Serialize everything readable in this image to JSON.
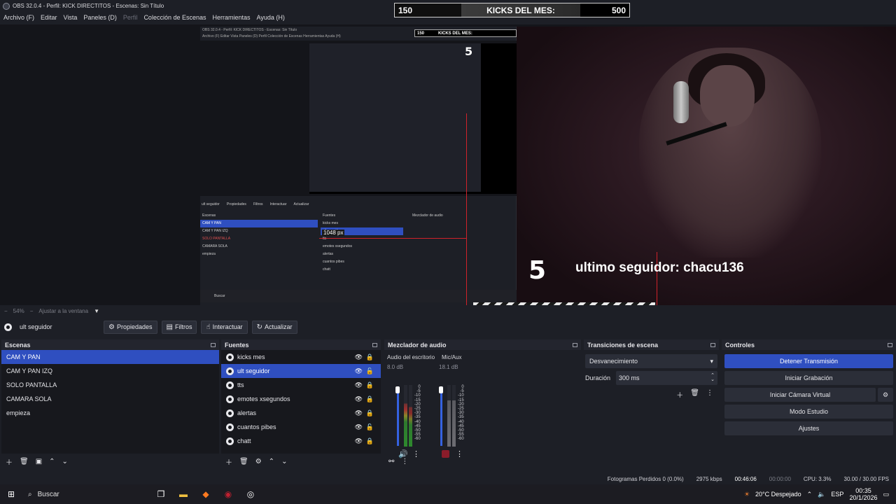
{
  "window": {
    "title": "OBS 32.0.4 - Perfil: KICK DIRECTITOS - Escenas: Sin Título"
  },
  "menu": [
    "Archivo (F)",
    "Editar",
    "Vista",
    "Paneles (D)",
    "Perfil",
    "Colección de Escenas",
    "Herramientas",
    "Ayuda (H)"
  ],
  "overlay": {
    "kicks_current": "150",
    "kicks_label": "KICKS DEL MES:",
    "kicks_goal": "500",
    "counter": "5",
    "last_follower": "ultimo seguidor: chacu136",
    "measure_label": "1048 px"
  },
  "nested": {
    "title": "OBS 32.0.4 - Perfil: KICK DIRECTITOS - Escenas: Sin Título",
    "menu": "Archivo (F)   Editar   Vista   Paneles (D)   Perfil   Colección de Escenas   Herramientas   Ayuda (H)",
    "banner_left": "150",
    "banner_label": "KICKS DEL MES:",
    "toolbar": [
      "ult seguidor",
      "Propiedades",
      "Filtros",
      "Interactuar",
      "Actualizar"
    ],
    "scenes_header": "Escenas",
    "sources_header": "Fuentes",
    "mixer_header": "Mezclador de audio",
    "scenes": [
      "CAM Y PAN",
      "CAM Y PAN IZQ",
      "SOLO PANTALLA",
      "CAMARA SOLA",
      "empieza"
    ],
    "sources": [
      "kicks mes",
      "ult seguidor",
      "tts",
      "emotes xsegundos",
      "alertas",
      "cuantos pibes",
      "chatt"
    ],
    "search": "Buscar",
    "weather": "20°C Despejado"
  },
  "zoom": {
    "level": "54%",
    "fit": "Ajustar a la ventana"
  },
  "source_toolbar": {
    "selected_source": "ult seguidor",
    "properties": "Propiedades",
    "filters": "Filtros",
    "interact": "Interactuar",
    "refresh": "Actualizar"
  },
  "scenes": {
    "header": "Escenas",
    "items": [
      "CAM Y PAN",
      "CAM Y PAN IZQ",
      "SOLO PANTALLA",
      "CAMARA SOLA",
      "empieza"
    ],
    "selected_index": 0
  },
  "sources": {
    "header": "Fuentes",
    "items": [
      {
        "name": "kicks mes",
        "locked": true
      },
      {
        "name": "ult seguidor",
        "locked": false
      },
      {
        "name": "tts",
        "locked": true
      },
      {
        "name": "emotes xsegundos",
        "locked": true
      },
      {
        "name": "alertas",
        "locked": true
      },
      {
        "name": "cuantos pibes",
        "locked": false
      },
      {
        "name": "chatt",
        "locked": true
      }
    ],
    "selected_index": 1
  },
  "mixer": {
    "header": "Mezclador de audio",
    "channels": [
      {
        "name": "Audio del escritorio",
        "db": "8.0 dB",
        "muted": false
      },
      {
        "name": "Mic/Aux",
        "db": "18.1 dB",
        "muted": true
      }
    ],
    "scale": [
      "0",
      "-5",
      "-10",
      "-15",
      "-20",
      "-25",
      "-30",
      "-35",
      "-40",
      "-45",
      "-50",
      "-55",
      "-60"
    ]
  },
  "transitions": {
    "header": "Transiciones de escena",
    "selected": "Desvanecimiento",
    "duration_label": "Duración",
    "duration_value": "300 ms"
  },
  "controls": {
    "header": "Controles",
    "stop_stream": "Detener Transmisión",
    "start_recording": "Iniciar Grabación",
    "start_virtual_cam": "Iniciar Cámara Virtual",
    "studio_mode": "Modo Estudio",
    "settings": "Ajustes"
  },
  "status": {
    "dropped_frames": "Fotogramas Perdidos 0 (0.0%)",
    "bitrate": "2975 kbps",
    "stream_time": "00:46:06",
    "rec_time": "00:00:00",
    "cpu": "CPU: 3.3%",
    "fps": "30.00 / 30.00 FPS"
  },
  "taskbar": {
    "search": "Buscar",
    "weather": "20°C Despejado",
    "lang": "ESP",
    "time": "00:35",
    "date": "20/1/2026"
  },
  "colors": {
    "accent": "#2f4fc0",
    "panel_bg": "#1d1f26",
    "list_bg": "#17181d",
    "guide_red": "#d0222a"
  }
}
